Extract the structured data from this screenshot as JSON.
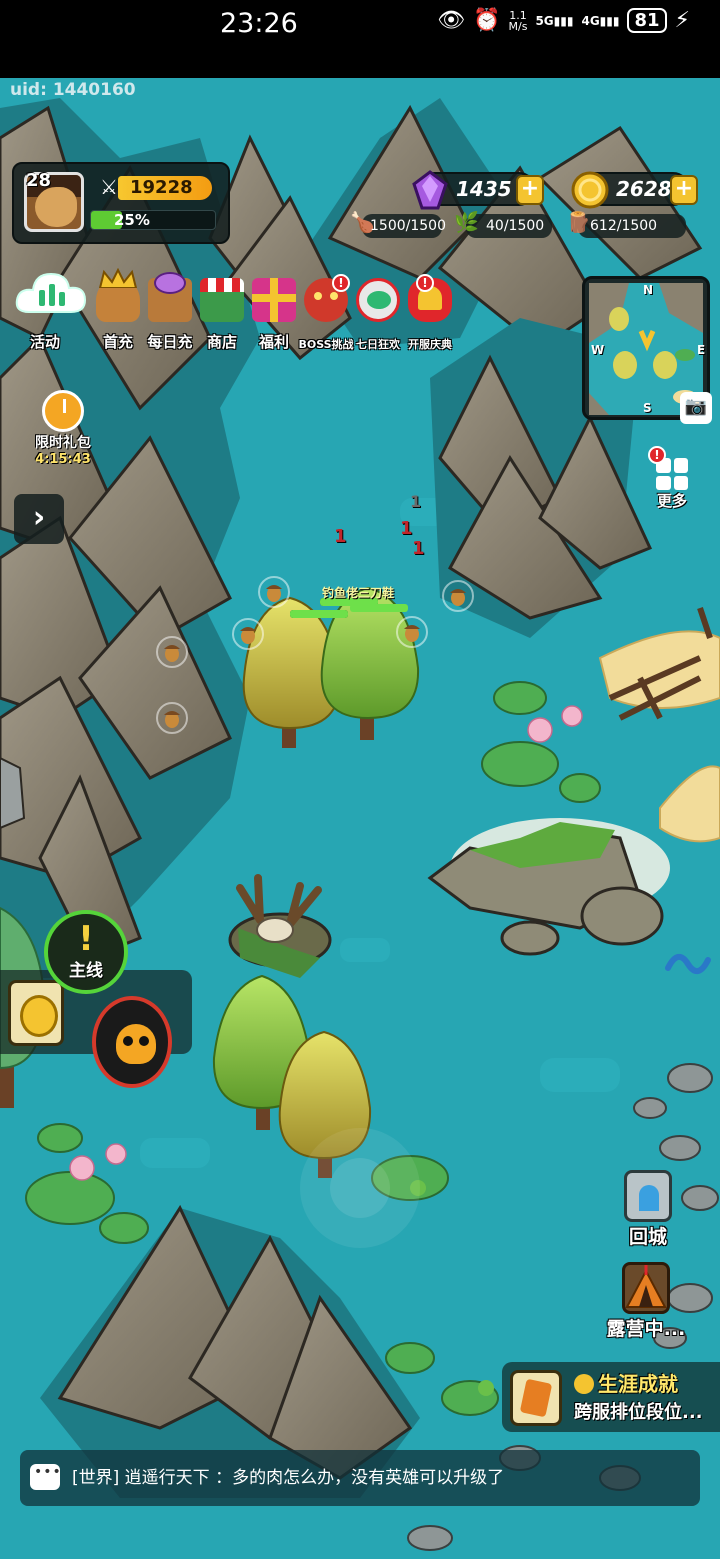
{
  "status_bar": {
    "time": "23:26",
    "net_speed_top": "1.1",
    "net_speed_bottom": "M/s",
    "sig1": "5G",
    "sig2": "4G",
    "battery": "81"
  },
  "game": {
    "uid": "uid: 1440160",
    "player": {
      "level": "28",
      "power": "19228",
      "exp_percent": "25%",
      "exp_fraction": 0.25
    },
    "currencies": {
      "gems": "1435",
      "gold": "2628"
    },
    "resources": {
      "meat": "1500/1500",
      "herb": "40/1500",
      "wood": "612/1500"
    },
    "events": [
      {
        "label": "活动",
        "icon": "cloud-activity-icon",
        "dot": false
      },
      {
        "label": "首充",
        "icon": "king-icon",
        "dot": false
      },
      {
        "label": "每日充",
        "icon": "gem-cart-icon",
        "dot": false
      },
      {
        "label": "商店",
        "icon": "shop-icon",
        "dot": false
      },
      {
        "label": "福利",
        "icon": "gift-icon",
        "dot": false
      },
      {
        "label": "BOSS挑战",
        "icon": "boss-icon",
        "dot": true
      },
      {
        "label": "七日狂欢",
        "icon": "carnival-icon",
        "dot": false
      },
      {
        "label": "开服庆典",
        "icon": "celebration-icon",
        "dot": true
      }
    ],
    "red_dot_mark": "!",
    "limited_pack": {
      "label": "限时礼包",
      "timer": "4:15:43"
    },
    "expand_arrow": "›",
    "minimap": {
      "n": "N",
      "s": "S",
      "w": "W",
      "e": "E"
    },
    "more_label": "更多",
    "quest": {
      "mark": "!",
      "label": "主线"
    },
    "floating_numbers": [
      "1",
      "1",
      "1",
      "1"
    ],
    "unit_name": "钓鱼佬三刀鞋",
    "return_city": "回城",
    "camp": "露营中...",
    "achievement": {
      "title": "生涯成就",
      "subtitle": "跨服排位段位..."
    },
    "chat": {
      "channel": "[世界]",
      "message": " 逍遥行天下 ：多的肉怎么办，没有英雄可以升级了"
    },
    "colors": {
      "water": "#27a6b3",
      "mountain": "#8a8270",
      "exp_green": "#5ecb33",
      "gold": "#f4c430",
      "alert_red": "#e0262b"
    }
  }
}
